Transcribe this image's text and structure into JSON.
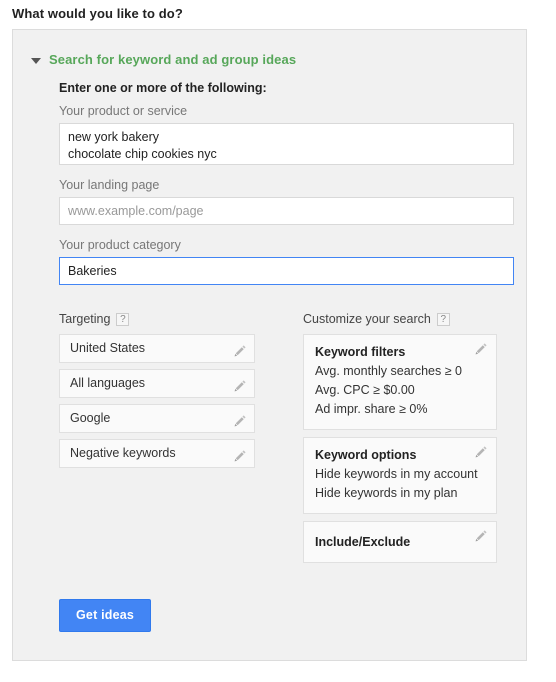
{
  "page": {
    "title": "What would you like to do?"
  },
  "section": {
    "disclosure_icon": "caret-down-icon",
    "title": "Search for keyword and ad group ideas",
    "subhead": "Enter one or more of the following:"
  },
  "fields": {
    "product_or_service": {
      "label": "Your product or service",
      "value_lines": [
        "new york bakery",
        "chocolate chip cookies nyc"
      ]
    },
    "landing_page": {
      "label": "Your landing page",
      "value": "",
      "placeholder": "www.example.com/page"
    },
    "product_category": {
      "label": "Your product category",
      "value": "Bakeries",
      "focused": true
    }
  },
  "targeting": {
    "heading": "Targeting",
    "help_icon": "help-question-icon",
    "help_label": "?",
    "items": [
      {
        "label": "United States",
        "edit_icon": "pencil-icon"
      },
      {
        "label": "All languages",
        "edit_icon": "pencil-icon"
      },
      {
        "label": "Google",
        "edit_icon": "pencil-icon"
      },
      {
        "label": "Negative keywords",
        "edit_icon": "pencil-icon"
      }
    ]
  },
  "customize": {
    "heading": "Customize your search",
    "help_icon": "help-question-icon",
    "help_label": "?",
    "cards": [
      {
        "title": "Keyword filters",
        "edit_icon": "pencil-icon",
        "lines": [
          "Avg. monthly searches ≥ 0",
          "Avg. CPC ≥ $0.00",
          "Ad impr. share ≥ 0%"
        ]
      },
      {
        "title": "Keyword options",
        "edit_icon": "pencil-icon",
        "lines": [
          "Hide keywords in my account",
          "Hide keywords in my plan"
        ]
      },
      {
        "title": "Include/Exclude",
        "edit_icon": "pencil-icon",
        "lines": []
      }
    ]
  },
  "actions": {
    "get_ideas_label": "Get ideas"
  },
  "colors": {
    "accent_blue": "#4285f4",
    "section_green": "#57a75a",
    "panel_bg": "#f1f1f1"
  }
}
